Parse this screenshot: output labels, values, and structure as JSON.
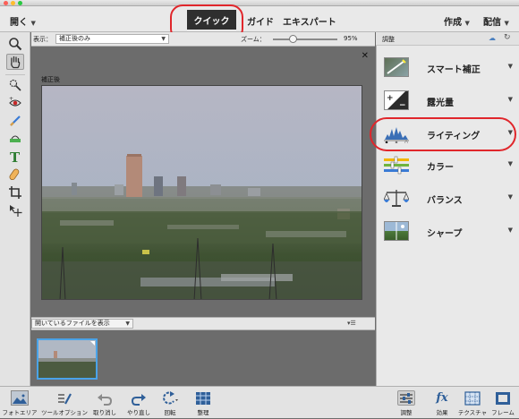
{
  "menubar": {
    "open_label": "開く",
    "tabs": [
      {
        "label": "クイック"
      },
      {
        "label": "ガイド"
      },
      {
        "label": "エキスパート"
      }
    ],
    "create_label": "作成",
    "share_label": "配信"
  },
  "viewbar": {
    "display_label": "表示：",
    "display_value": "補正後のみ",
    "zoom_label": "ズーム：",
    "zoom_value": "95%",
    "zoom_level": 0.95
  },
  "canvas": {
    "photo_label": "補正後"
  },
  "bin": {
    "dropdown_value": "開いているファイルを表示"
  },
  "right_panel": {
    "title": "調整",
    "adjustments": [
      {
        "label": "スマート補正",
        "icon": "smart-fix-icon"
      },
      {
        "label": "露光量",
        "icon": "exposure-icon"
      },
      {
        "label": "ライティング",
        "icon": "lighting-icon"
      },
      {
        "label": "カラー",
        "icon": "color-icon"
      },
      {
        "label": "バランス",
        "icon": "balance-icon"
      },
      {
        "label": "シャープ",
        "icon": "sharpen-icon"
      }
    ]
  },
  "bottombar": {
    "photo_bin": "フォトエリア",
    "tool_options": "ツールオプション",
    "undo": "取り消し",
    "redo": "やり直し",
    "rotate": "回転",
    "organize": "整理",
    "adjust": "調整",
    "effects": "効果",
    "textures": "テクスチャ",
    "frames": "フレーム"
  },
  "colors": {
    "highlight_ring": "#e0262b",
    "selected_tab": "#2f2f2f",
    "thumbnail_border": "#4aa3e8"
  }
}
